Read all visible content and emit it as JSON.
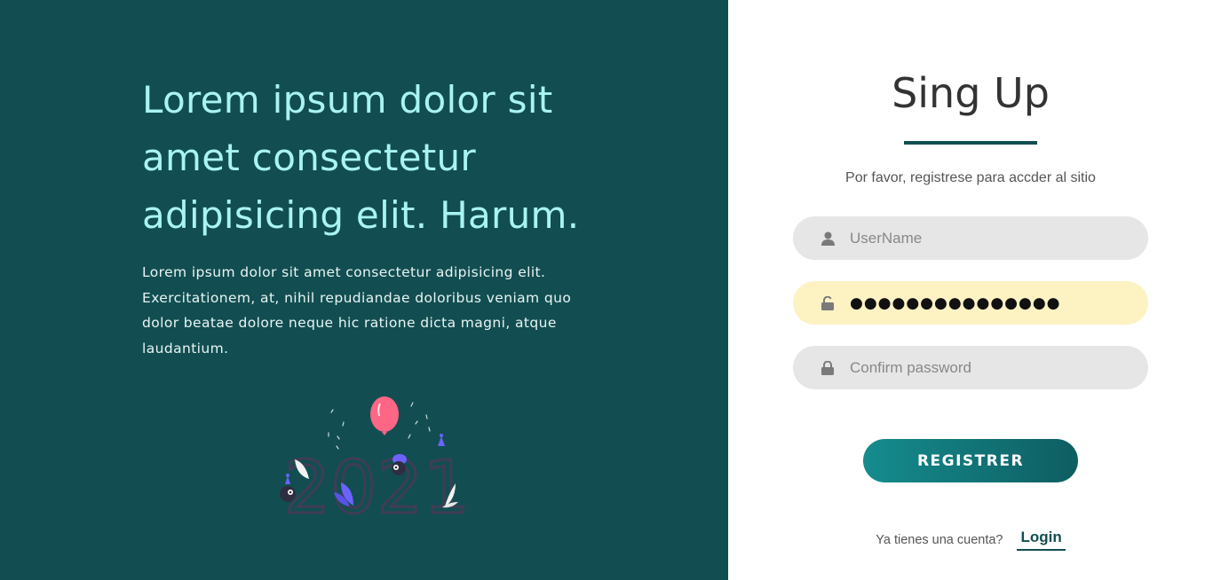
{
  "hero": {
    "title": "Lorem ipsum dolor sit amet consectetur adipisicing elit. Harum.",
    "text": "Lorem ipsum dolor sit amet consectetur adipisicing elit. Exercitationem, at, nihil repudiandae doloribus veniam quo dolor beatae dolore neque hic ratione dicta magni, atque laudantium.",
    "illustration_text": "2021"
  },
  "form": {
    "title": "Sing Up",
    "subtitle": "Por favor, registrese para accder al sitio",
    "username": {
      "placeholder": "UserName",
      "icon": "user-icon"
    },
    "password": {
      "value": "●●●●●●●●●●●●●●●",
      "icon": "unlock-icon"
    },
    "confirm": {
      "placeholder": "Confirm password",
      "icon": "lock-icon"
    },
    "submit_label": "REGISTRER",
    "login_prompt": "Ya tienes una cuenta?",
    "login_label": "Login"
  },
  "colors": {
    "panel": "#124e51",
    "accent": "#a9f3f3",
    "input_bg": "#e6e6e6",
    "autofill_bg": "#fdf2c2",
    "button_start": "#158c8e",
    "button_end": "#0e5d61"
  }
}
